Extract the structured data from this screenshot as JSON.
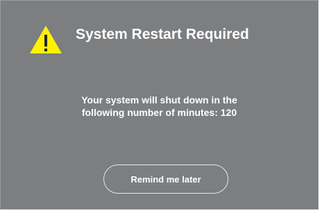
{
  "dialog": {
    "icon": "warning-triangle-icon",
    "title": "System Restart Required",
    "message": {
      "line1": "Your system will shut down in the",
      "line2": "following number of minutes: 120"
    },
    "button_label": "Remind me later"
  },
  "colors": {
    "dialog_background": "#7c7e80",
    "warning_yellow": "#fff200",
    "text": "#ffffff"
  }
}
